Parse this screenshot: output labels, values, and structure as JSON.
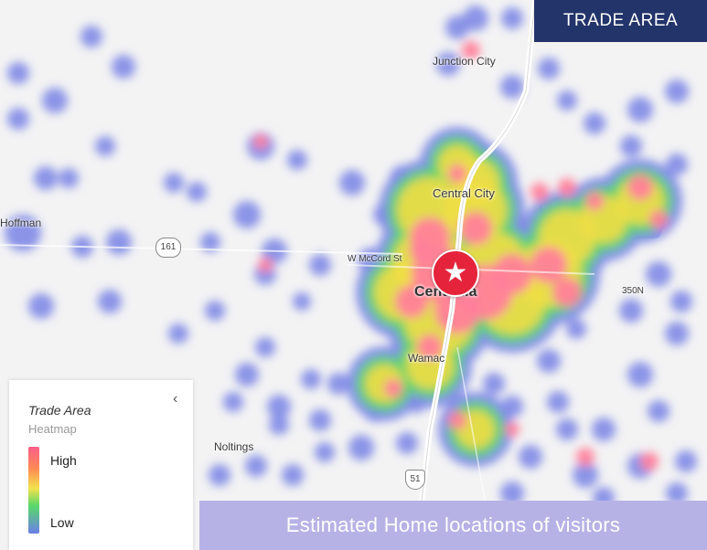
{
  "header": {
    "badge": "TRADE AREA"
  },
  "banner": {
    "text": "Estimated Home locations of visitors"
  },
  "legend": {
    "title": "Trade Area",
    "subtitle": "Heatmap",
    "high": "High",
    "low": "Low",
    "collapse_icon": "chevron-left-icon"
  },
  "map": {
    "places": {
      "junction_city": "Junction City",
      "central_city": "Central City",
      "hoffman": "Hoffman",
      "centralia": "Centralia",
      "wamac": "Wamac",
      "noltings": "Noltings",
      "mccord": "W McCord St",
      "road_350n": "350N"
    },
    "routes": {
      "state_161": "161",
      "us_51": "51"
    },
    "marker_icon": "star-icon",
    "colors": {
      "low": "#7f8ae6",
      "mid": "#5fd46a",
      "warm": "#f1de45",
      "high": "#ff7f9a",
      "accent": "#23346a"
    }
  }
}
